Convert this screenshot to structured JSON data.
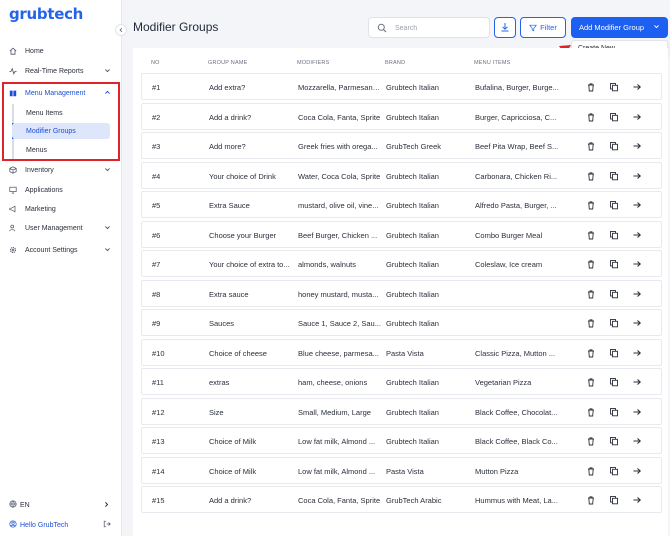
{
  "app": {
    "logo": "grubtech"
  },
  "sidebar": {
    "items": [
      {
        "label": "Home",
        "icon": "home-icon"
      },
      {
        "label": "Real-Time Reports",
        "icon": "pulse-icon"
      },
      {
        "label": "Menu Management",
        "icon": "book-icon"
      },
      {
        "label": "Inventory",
        "icon": "box-icon"
      },
      {
        "label": "Applications",
        "icon": "monitor-icon"
      },
      {
        "label": "Marketing",
        "icon": "megaphone-icon"
      },
      {
        "label": "User Management",
        "icon": "users-icon"
      },
      {
        "label": "Account Settings",
        "icon": "gear-icon"
      }
    ],
    "sub_items": [
      {
        "label": "Menu Items"
      },
      {
        "label": "Modifier Groups"
      },
      {
        "label": "Menus"
      }
    ],
    "language": "EN",
    "user": "Hello GrubTech"
  },
  "page": {
    "title": "Modifier Groups",
    "search_placeholder": "Search",
    "filter_label": "Filter",
    "add_label": "Add Modifier Group",
    "dropdown_option": "Create New"
  },
  "table": {
    "headers": {
      "no": "NO",
      "name": "GROUP NAME",
      "modifiers": "MODIFIERS",
      "brand": "BRAND",
      "menu": "MENU ITEMS"
    },
    "rows": [
      {
        "no": "#1",
        "name": "Add extra?",
        "modifiers": "Mozzarella, Parmesan, ...",
        "brand": "Grubtech Italian",
        "menu": "Bufalina, Burger, Burge..."
      },
      {
        "no": "#2",
        "name": "Add a drink?",
        "modifiers": "Coca Cola, Fanta, Sprite",
        "brand": "Grubtech Italian",
        "menu": "Burger, Capricciosa, C..."
      },
      {
        "no": "#3",
        "name": "Add more?",
        "modifiers": "Greek fries with orega...",
        "brand": "GrubTech Greek",
        "menu": "Beef Pita Wrap, Beef S..."
      },
      {
        "no": "#4",
        "name": "Your choice of Drink",
        "modifiers": "Water, Coca Cola, Sprite",
        "brand": "Grubtech Italian",
        "menu": "Carbonara, Chicken Ri..."
      },
      {
        "no": "#5",
        "name": "Extra Sauce",
        "modifiers": "mustard, olive oil, vine...",
        "brand": "Grubtech Italian",
        "menu": "Alfredo Pasta, Burger, ..."
      },
      {
        "no": "#6",
        "name": "Choose your Burger",
        "modifiers": "Beef Burger, Chicken ...",
        "brand": "Grubtech Italian",
        "menu": "Combo Burger Meal"
      },
      {
        "no": "#7",
        "name": "Your choice of extra to...",
        "modifiers": "almonds, walnuts",
        "brand": "Grubtech Italian",
        "menu": "Coleslaw, Ice cream"
      },
      {
        "no": "#8",
        "name": "Extra sauce",
        "modifiers": "honey mustard, musta...",
        "brand": "Grubtech Italian",
        "menu": ""
      },
      {
        "no": "#9",
        "name": "Sauces",
        "modifiers": "Sauce 1, Sauce 2, Sau...",
        "brand": "Grubtech Italian",
        "menu": ""
      },
      {
        "no": "#10",
        "name": "Choice of cheese",
        "modifiers": "Blue cheese, parmesa...",
        "brand": "Pasta Vista",
        "menu": "Classic Pizza, Mutton ..."
      },
      {
        "no": "#11",
        "name": "extras",
        "modifiers": "ham, cheese, onions",
        "brand": "Grubtech Italian",
        "menu": "Vegetarian Pizza"
      },
      {
        "no": "#12",
        "name": "Size",
        "modifiers": "Small, Medium, Large",
        "brand": "Grubtech Italian",
        "menu": "Black Coffee, Chocolat..."
      },
      {
        "no": "#13",
        "name": "Choice of Milk",
        "modifiers": "Low fat milk, Almond ...",
        "brand": "Grubtech Italian",
        "menu": "Black Coffee, Black Co..."
      },
      {
        "no": "#14",
        "name": "Choice of Milk",
        "modifiers": "Low fat milk, Almond ...",
        "brand": "Pasta Vista",
        "menu": "Mutton Pizza"
      },
      {
        "no": "#15",
        "name": "Add a drink?",
        "modifiers": "Coca Cola, Fanta, Sprite",
        "brand": "GrubTech Arabic",
        "menu": "Hummus with Meat, La..."
      }
    ]
  },
  "colors": {
    "accent": "#1d5ff0",
    "highlight": "#e0232b",
    "selected_bg": "#dde6fb"
  }
}
